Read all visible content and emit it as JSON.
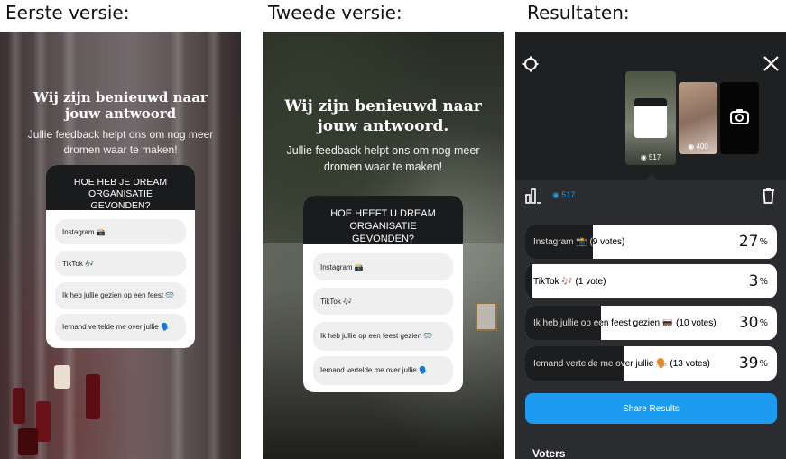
{
  "captions": {
    "first": "Eerste versie:",
    "second": "Tweede versie:",
    "results": "Resultaten:"
  },
  "version1": {
    "title": "Wij zijn benieuwd naar jouw antwoord",
    "subtitle": "Jullie feedback helpt ons om nog meer dromen waar te maken!",
    "question": "HOE HEB JE DREAM ORGANISATIE GEVONDEN?",
    "options": [
      "Instagram 📸",
      "TikTok 🎶",
      "Ik heb jullie gezien op een feest 🥽",
      "Iemand vertelde me over jullie 🗣️"
    ]
  },
  "version2": {
    "title": "Wij zijn benieuwd naar jouw antwoord.",
    "subtitle": "Jullie feedback helpt ons om nog meer dromen waar te maken!",
    "question": "HOE HEEFT U DREAM ORGANISATIE GEVONDEN?",
    "options": [
      "Instagram 📸",
      "TikTok 🎶",
      "Ik heb jullie op een feest gezien 🥽",
      "Iemand vertelde me over jullie 🗣️"
    ]
  },
  "results": {
    "views_main": "517",
    "views_thumb1": "517",
    "views_thumb2": "400",
    "views_header": "517",
    "share_label": "Share Results",
    "voters_label": "Voters",
    "rows": [
      {
        "label": "Instagram 📸 (9 votes)",
        "pct": "27",
        "share": 0.27
      },
      {
        "label": "TikTok 🎶 (1 vote)",
        "pct": "3",
        "share": 0.03
      },
      {
        "label": "Ik heb jullie op een feest gezien 🥽 (10 votes)",
        "pct": "30",
        "share": 0.3
      },
      {
        "label": "Iemand vertelde me over jullie 🗣️ (13 votes)",
        "pct": "39",
        "share": 0.39
      }
    ],
    "accent": "#1d9bf0"
  },
  "icons": {
    "settings": "settings-gear-icon",
    "close": "close-icon",
    "camera": "camera-icon",
    "chart": "bar-chart-icon",
    "eye": "eye-icon",
    "trash": "trash-icon"
  }
}
